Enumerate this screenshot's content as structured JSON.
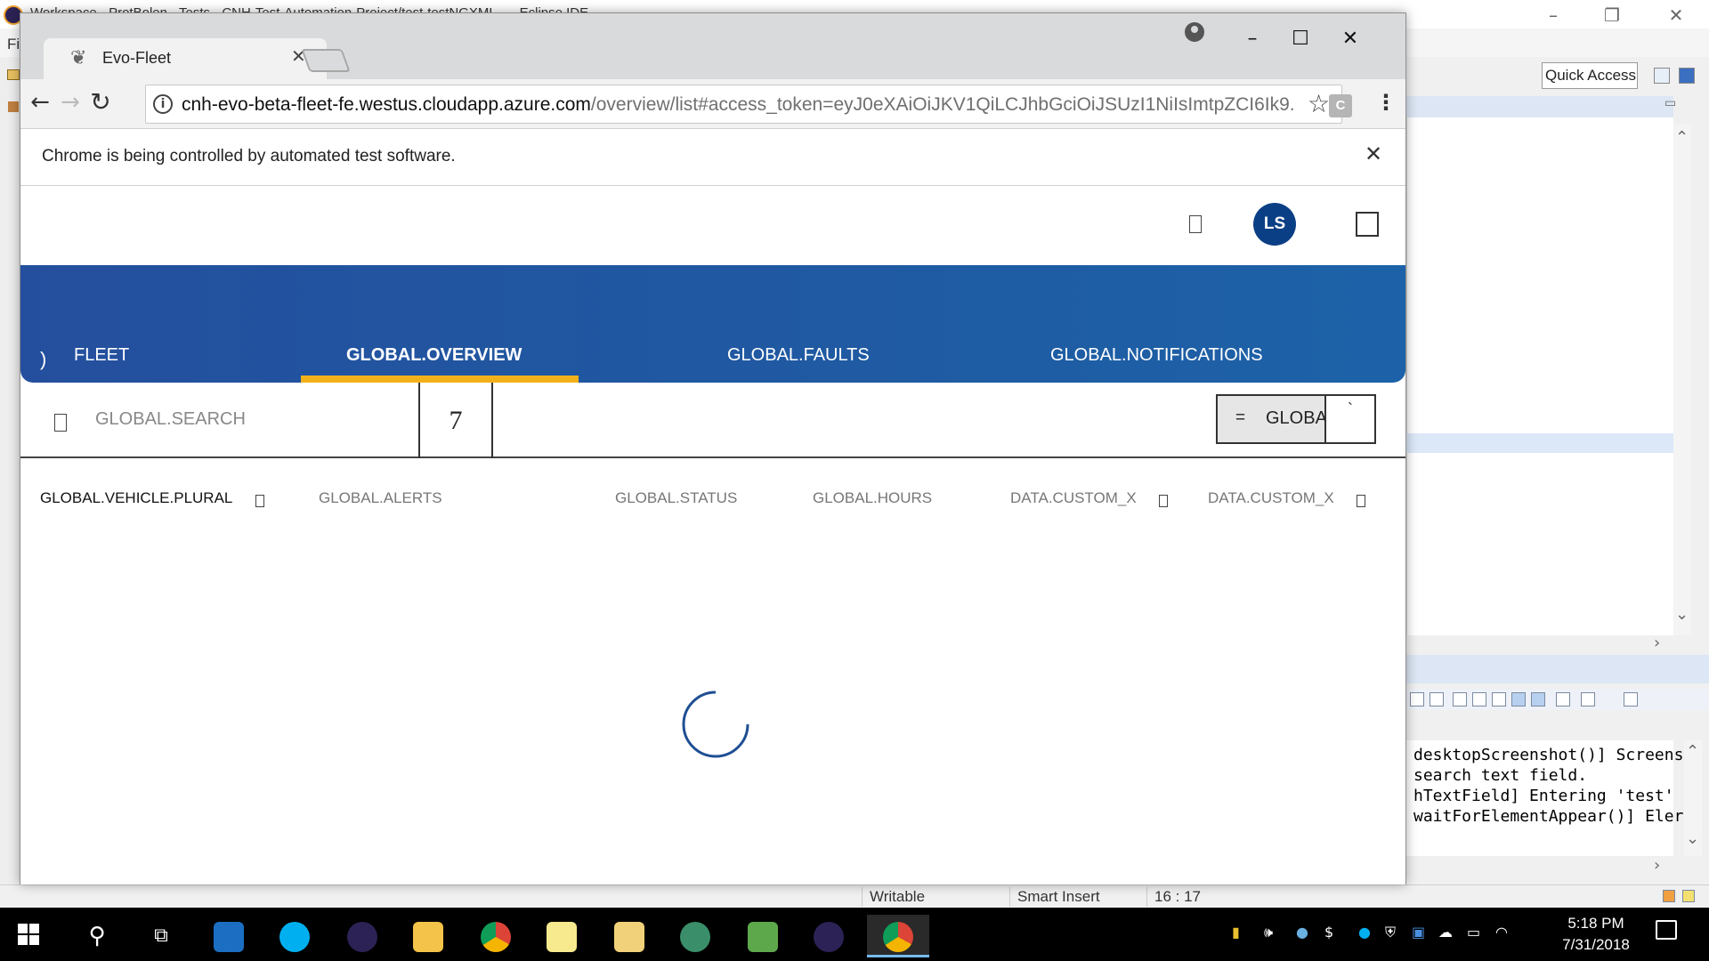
{
  "eclipse": {
    "title": "Workspace - ProtBolen - Tests - CNH-Test-Automation-Project/test-testNGXML... - Eclipse IDE",
    "menu_first": "Fil",
    "quick_access": "Quick Access",
    "console_lines": [
      " desktopScreenshot()] Screens",
      " search text field.",
      "hTextField] Entering 'test' i",
      " waitForElementAppear()] Eler"
    ],
    "status": {
      "writable": "Writable",
      "insert_mode": "Smart Insert",
      "position": "16 : 17"
    }
  },
  "chrome": {
    "tab_title": "Evo-Fleet",
    "url_host": "cnh-evo-beta-fleet-fe.westus.cloudapp.azure.com",
    "url_path": "/overview/list#access_token=eyJ0eXAiOiJKV1QiLCJhbGciOiJSUzI1NiIsImtpZCI6Ik9...",
    "extension_label": "C",
    "infobar_text": "Chrome is being controlled by automated test software."
  },
  "app": {
    "avatar_initials": "LS",
    "nav_paren": ")",
    "tabs": [
      {
        "label": "FLEET"
      },
      {
        "label": "GLOBAL.OVERVIEW",
        "active": true
      },
      {
        "label": "GLOBAL.FAULTS"
      },
      {
        "label": "GLOBAL.NOTIFICATIONS"
      }
    ],
    "accent_color": "#f2b11b",
    "search_placeholder": "GLOBAL.SEARCH",
    "filter_count": "7",
    "filter_select_eq": "=",
    "filter_select_label": "GLOBA",
    "filter_select_btn": "`",
    "columns": [
      "GLOBAL.VEHICLE.PLURAL",
      "GLOBAL.ALERTS",
      "GLOBAL.STATUS",
      "GLOBAL.HOURS",
      "DATA.CUSTOM_X",
      "DATA.CUSTOM_X"
    ]
  },
  "taskbar": {
    "time": "5:18 PM",
    "date": "7/31/2018"
  }
}
